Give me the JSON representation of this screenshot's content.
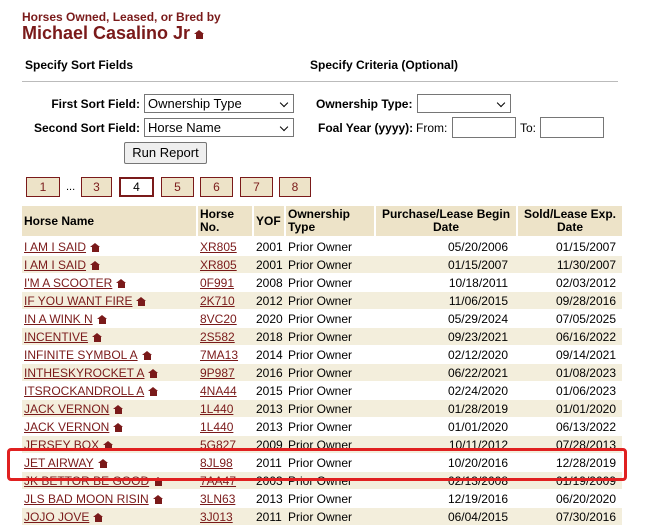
{
  "header": {
    "subtitle": "Horses Owned, Leased, or Bred by",
    "name": "Michael Casalino Jr"
  },
  "sections": {
    "sort_fields": "Specify Sort Fields",
    "criteria": "Specify Criteria (Optional)"
  },
  "form": {
    "first_sort_label": "First Sort Field:",
    "first_sort_value": "Ownership Type",
    "second_sort_label": "Second Sort Field:",
    "second_sort_value": "Horse Name",
    "ownership_type_label": "Ownership Type:",
    "ownership_type_value": "",
    "foal_year_label": "Foal Year (yyyy):",
    "from_label": "From:",
    "to_label": "To:",
    "run_button": "Run Report"
  },
  "pager": {
    "first": "1",
    "ellipsis": "...",
    "pages": [
      "3",
      "4",
      "5",
      "6",
      "7",
      "8"
    ],
    "current": "4"
  },
  "table": {
    "headers": {
      "horse_name": "Horse Name",
      "horse_no": "Horse No.",
      "yof": "YOF",
      "ownership_type": "Ownership Type",
      "begin_date": "Purchase/Lease Begin Date",
      "end_date": "Sold/Lease Exp. Date"
    },
    "rows": [
      {
        "name": "I AM I SAID",
        "no": "XR805",
        "yof": "2001",
        "type": "Prior Owner",
        "begin": "05/20/2006",
        "end": "01/15/2007"
      },
      {
        "name": "I AM I SAID",
        "no": "XR805",
        "yof": "2001",
        "type": "Prior Owner",
        "begin": "01/15/2007",
        "end": "11/30/2007"
      },
      {
        "name": "I'M A SCOOTER",
        "no": "0F991",
        "yof": "2008",
        "type": "Prior Owner",
        "begin": "10/18/2011",
        "end": "02/03/2012"
      },
      {
        "name": "IF YOU WANT FIRE",
        "no": "2K710",
        "yof": "2012",
        "type": "Prior Owner",
        "begin": "11/06/2015",
        "end": "09/28/2016"
      },
      {
        "name": "IN A WINK N",
        "no": "8VC20",
        "yof": "2020",
        "type": "Prior Owner",
        "begin": "05/29/2024",
        "end": "07/05/2025"
      },
      {
        "name": "INCENTIVE",
        "no": "2S582",
        "yof": "2018",
        "type": "Prior Owner",
        "begin": "09/23/2021",
        "end": "06/16/2022"
      },
      {
        "name": "INFINITE SYMBOL A",
        "no": "7MA13",
        "yof": "2014",
        "type": "Prior Owner",
        "begin": "02/12/2020",
        "end": "09/14/2021"
      },
      {
        "name": "INTHESKYROCKET A",
        "no": "9P987",
        "yof": "2016",
        "type": "Prior Owner",
        "begin": "06/22/2021",
        "end": "01/08/2023"
      },
      {
        "name": "ITSROCKANDROLL A",
        "no": "4NA44",
        "yof": "2015",
        "type": "Prior Owner",
        "begin": "02/24/2020",
        "end": "01/06/2023"
      },
      {
        "name": "JACK VERNON",
        "no": "1L440",
        "yof": "2013",
        "type": "Prior Owner",
        "begin": "01/28/2019",
        "end": "01/01/2020"
      },
      {
        "name": "JACK VERNON",
        "no": "1L440",
        "yof": "2013",
        "type": "Prior Owner",
        "begin": "01/01/2020",
        "end": "06/13/2022"
      },
      {
        "name": "JERSEY BOX",
        "no": "5G827",
        "yof": "2009",
        "type": "Prior Owner",
        "begin": "10/11/2012",
        "end": "07/28/2013"
      },
      {
        "name": "JET AIRWAY",
        "no": "8JL98",
        "yof": "2011",
        "type": "Prior Owner",
        "begin": "10/20/2016",
        "end": "12/28/2019"
      },
      {
        "name": "JK BETTOR BE GOOD",
        "no": "7AA47",
        "yof": "2003",
        "type": "Prior Owner",
        "begin": "02/13/2008",
        "end": "01/19/2009"
      },
      {
        "name": "JLS BAD MOON RISIN",
        "no": "3LN63",
        "yof": "2013",
        "type": "Prior Owner",
        "begin": "12/19/2016",
        "end": "06/20/2020"
      },
      {
        "name": "JOJO JOVE",
        "no": "3J013",
        "yof": "2011",
        "type": "Prior Owner",
        "begin": "06/04/2015",
        "end": "07/30/2016"
      }
    ]
  },
  "colors": {
    "accent": "#7a1a1a",
    "header_bg": "#ede3c8",
    "alt_row_bg": "#f3eedc",
    "highlight": "#e02020"
  },
  "icons": {
    "home": "home-icon"
  }
}
